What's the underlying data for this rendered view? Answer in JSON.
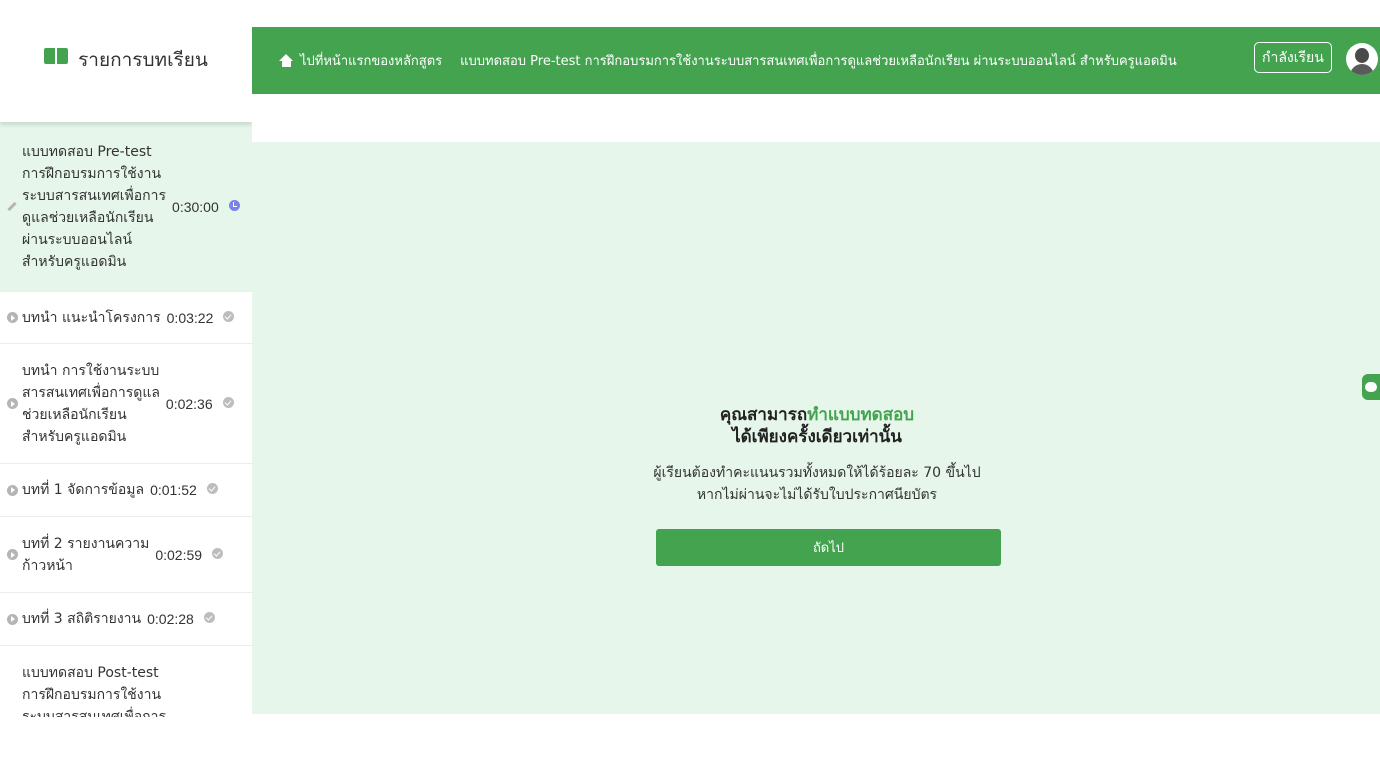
{
  "sidebar": {
    "title": "รายการบทเรียน",
    "lessons": [
      {
        "lines": [
          "แบบทดสอบ Pre-test",
          "การฝึกอบรมการใช้งาน",
          "ระบบสารสนเทศเพื่อการ",
          "ดูแลช่วยเหลือนักเรียน",
          "ผ่านระบบออนไลน์",
          "สำหรับครูแอดมิน"
        ],
        "duration": "0:30:00",
        "lead_icon": "pencil-icon",
        "status_icon": "clock-icon",
        "active": true
      },
      {
        "lines": [
          "บทนำ แนะนำโครงการ"
        ],
        "duration": "0:03:22",
        "lead_icon": "play-icon",
        "status_icon": "check-icon"
      },
      {
        "lines": [
          "บทนำ การใช้งานระบบ",
          "สารสนเทศเพื่อการดูแล",
          "ช่วยเหลือนักเรียน",
          "สำหรับครูแอดมิน"
        ],
        "duration": "0:02:36",
        "lead_icon": "play-icon",
        "status_icon": "check-icon"
      },
      {
        "lines": [
          "บทที่ 1 จัดการข้อมูล"
        ],
        "duration": "0:01:52",
        "lead_icon": "play-icon",
        "status_icon": "check-icon"
      },
      {
        "lines": [
          "บทที่ 2 รายงานความ",
          "ก้าวหน้า"
        ],
        "duration": "0:02:59",
        "lead_icon": "play-icon",
        "status_icon": "check-icon"
      },
      {
        "lines": [
          "บทที่ 3 สถิติรายงาน"
        ],
        "duration": "0:02:28",
        "lead_icon": "play-icon",
        "status_icon": "check-icon"
      },
      {
        "lines": [
          "แบบทดสอบ Post-test",
          "การฝึกอบรมการใช้งาน",
          "ระบบสารสนเทศเพื่อการ"
        ],
        "duration": "",
        "lead_icon": "",
        "status_icon": ""
      }
    ]
  },
  "topbar": {
    "home_label": "ไปที่หน้าแรกของหลักสูตร",
    "course_title": "แบบทดสอบ Pre-test การฝึกอบรมการใช้งานระบบสารสนเทศเพื่อการดูแลช่วยเหลือนักเรียน ผ่านระบบออนไลน์ สำหรับครูแอดมิน",
    "status_label": "กำลังเรียน"
  },
  "main": {
    "notice_prefix": "คุณสามารถ",
    "notice_highlight": "ทำแบบทดสอบ",
    "notice_line2": "ได้เพียงครั้งเดียวเท่านั้น",
    "requirement_line1": "ผู้เรียนต้องทำคะแนนรวมทั้งหมดให้ได้ร้อยละ 70 ขึ้นไป",
    "requirement_line2": "หากไม่ผ่านจะไม่ได้รับใบประกาศนียบัตร",
    "next_label": "ถัดไป"
  },
  "colors": {
    "brand_green": "#43a34f",
    "content_bg": "#e6f6ea"
  }
}
